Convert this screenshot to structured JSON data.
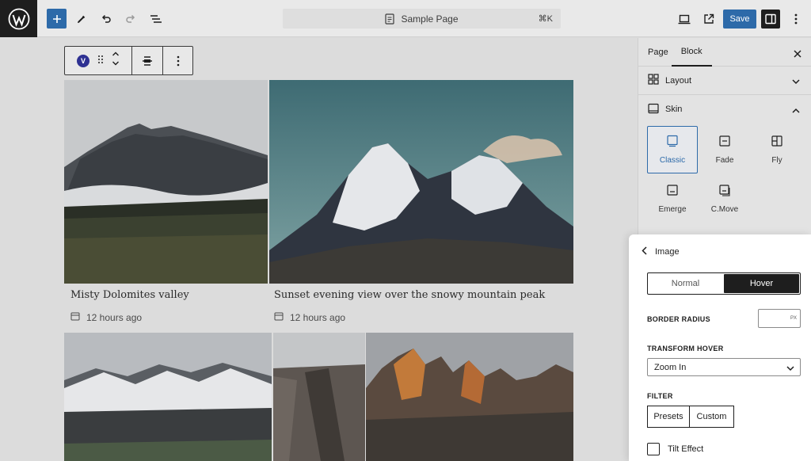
{
  "topbar": {
    "logo": "wordpress-logo",
    "document_title": "Sample Page",
    "shortcut": "⌘K",
    "save_label": "Save"
  },
  "block_toolbar": {
    "block_badge": "V"
  },
  "gallery": {
    "items": [
      {
        "caption": "Misty Dolomites valley",
        "time": "12 hours ago"
      },
      {
        "caption": "Sunset evening view over the snowy mountain peak",
        "time": "12 hours ago"
      }
    ]
  },
  "sidebar": {
    "tabs": [
      "Page",
      "Block"
    ],
    "active_tab": "Block",
    "sections": {
      "layout": "Layout",
      "skin": "Skin"
    },
    "skins": [
      {
        "label": "Classic",
        "icon": "classic-skin-icon",
        "active": true
      },
      {
        "label": "Fade",
        "icon": "fade-skin-icon",
        "active": false
      },
      {
        "label": "Fly",
        "icon": "fly-skin-icon",
        "active": false
      },
      {
        "label": "Emerge",
        "icon": "emerge-skin-icon",
        "active": false
      },
      {
        "label": "C.Move",
        "icon": "cmove-skin-icon",
        "active": false
      }
    ]
  },
  "image_panel": {
    "title": "Image",
    "state_tabs": [
      "Normal",
      "Hover"
    ],
    "active_state": "Hover",
    "border_radius_label": "BORDER RADIUS",
    "border_radius_unit": "PX",
    "border_radius_value": "",
    "transform_label": "TRANSFORM HOVER",
    "transform_value": "Zoom In",
    "filter_label": "FILTER",
    "filter_options": [
      "Presets",
      "Custom"
    ],
    "tilt_label": "Tilt Effect",
    "tilt_checked": false
  },
  "colors": {
    "accent": "#2d6aa9",
    "dark": "#1e1e1e"
  }
}
